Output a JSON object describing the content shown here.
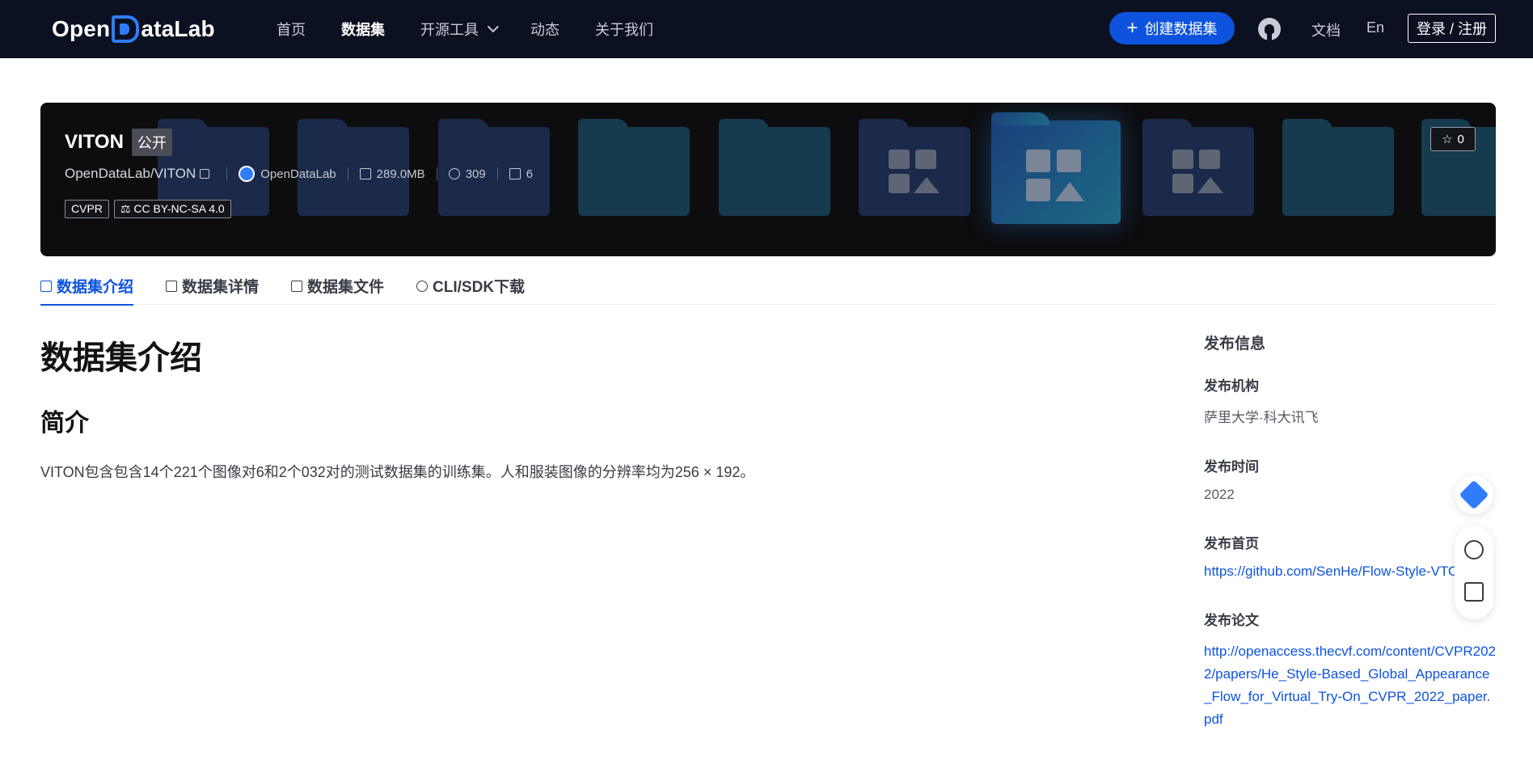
{
  "header": {
    "logo_text": "OpenDataLab",
    "nav": [
      "首页",
      "数据集",
      "开源工具",
      "动态",
      "关于我们"
    ],
    "create_label": "创建数据集",
    "docs_label": "文档",
    "lang_label": "En",
    "login_label": "登录 / 注册"
  },
  "dataset": {
    "name": "VITON",
    "visibility": "公开",
    "path": "OpenDataLab/VITON",
    "org": "OpenDataLab",
    "size": "289.0MB",
    "views": "309",
    "downloads": "6",
    "tags": [
      "CVPR",
      "CC BY-NC-SA 4.0"
    ],
    "stars": "0"
  },
  "tabs": [
    "数据集介绍",
    "数据集详情",
    "数据集文件",
    "CLI/SDK下载"
  ],
  "content": {
    "title": "数据集介绍",
    "section": "简介",
    "intro": "VITON包含包含14个221个图像对6和2个032对的测试数据集的训练集。人和服装图像的分辨率均为256 × 192。"
  },
  "sidebar": {
    "heading": "发布信息",
    "org_label": "发布机构",
    "org_value": "萨里大学·科大讯飞",
    "time_label": "发布时间",
    "time_value": "2022",
    "home_label": "发布首页",
    "home_value": "https://github.com/SenHe/Flow-Style-VTON",
    "paper_label": "发布论文",
    "paper_value": "http://openaccess.thecvf.com/content/CVPR2022/papers/He_Style-Based_Global_Appearance_Flow_for_Virtual_Try-On_CVPR_2022_paper.pdf"
  },
  "colors": {
    "accent": "#0d53de",
    "topbar": "#0b1120"
  }
}
